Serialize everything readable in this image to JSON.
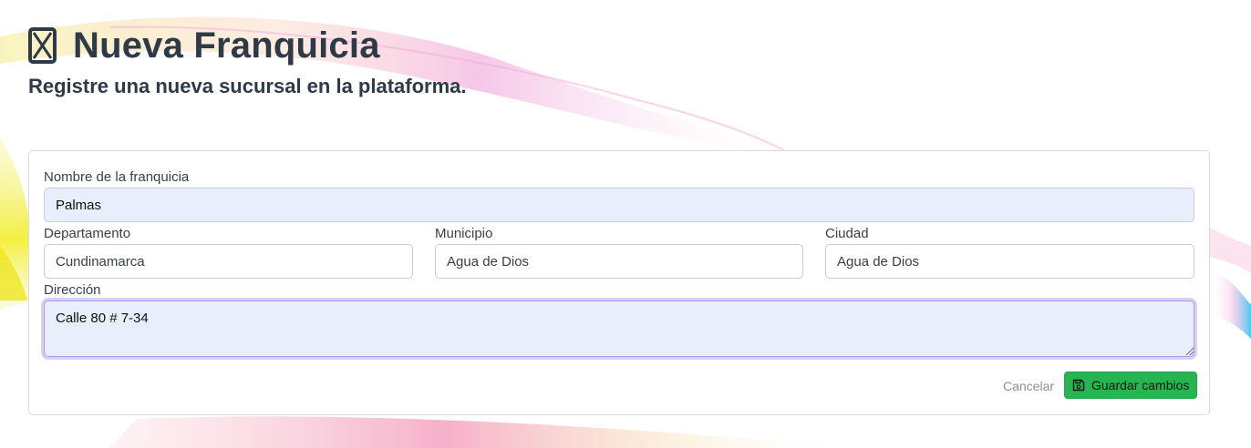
{
  "header": {
    "title": "Nueva Franquicia",
    "subtitle": "Registre una nueva sucursal en la plataforma.",
    "icon": "x-square-icon"
  },
  "form": {
    "nombre": {
      "label": "Nombre de la franquicia",
      "value": "Palmas"
    },
    "departamento": {
      "label": "Departamento",
      "value": "Cundinamarca"
    },
    "municipio": {
      "label": "Municipio",
      "value": "Agua de Dios"
    },
    "ciudad": {
      "label": "Ciudad",
      "value": "Agua de Dios"
    },
    "direccion": {
      "label": "Dirección",
      "value": "Calle 80 # 7-34"
    }
  },
  "actions": {
    "cancel_label": "Cancelar",
    "save_label": "Guardar cambios",
    "save_icon": "floppy-disk-icon"
  },
  "colors": {
    "title": "#2f3a48",
    "save_button": "#28b451",
    "autofill_bg": "#e8eefc",
    "focus_ring": "#a99bec"
  }
}
